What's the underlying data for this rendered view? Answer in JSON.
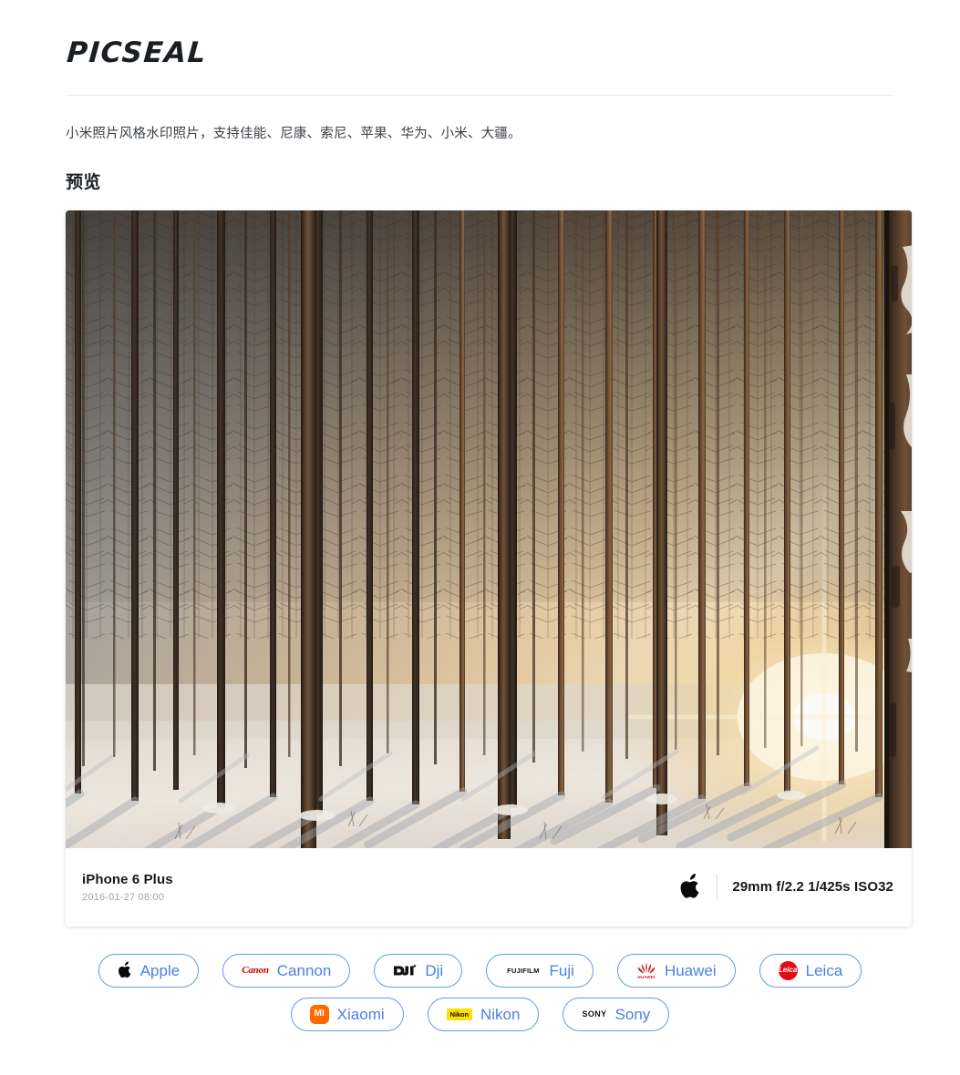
{
  "header": {
    "site_title": "PICSEAL"
  },
  "intro": {
    "description": "小米照片风格水印照片，支持佳能、尼康、索尼、苹果、华为、小米、大疆。"
  },
  "preview": {
    "section_heading": "预览",
    "photo_alt": "winter-larch-forest-sunrise-photo",
    "watermark": {
      "model": "iPhone 6 Plus",
      "date": "2016-01-27 08:00",
      "brand_logo": "apple-logo",
      "exif": "29mm f/2.2 1/425s ISO32"
    }
  },
  "brands": {
    "rows": [
      [
        {
          "label": "Apple",
          "logo": "apple-logo"
        },
        {
          "label": "Cannon",
          "logo": "canon-logo"
        },
        {
          "label": "Dji",
          "logo": "dji-logo"
        },
        {
          "label": "Fuji",
          "logo": "fujifilm-logo"
        },
        {
          "label": "Huawei",
          "logo": "huawei-logo"
        },
        {
          "label": "Leica",
          "logo": "leica-logo"
        }
      ],
      [
        {
          "label": "Xiaomi",
          "logo": "xiaomi-logo"
        },
        {
          "label": "Nikon",
          "logo": "nikon-logo"
        },
        {
          "label": "Sony",
          "logo": "sony-logo"
        }
      ]
    ],
    "logo_text": {
      "canon": "Canon",
      "fujifilm": "FUJIFILM",
      "sony": "SONY",
      "nikon": "Nikon",
      "xiaomi": "MI",
      "leica": "Leica",
      "huawei": "HUAWEI"
    }
  },
  "colors": {
    "accent_blue": "#4a7fe8",
    "pill_border": "#6699f0",
    "canon_red": "#cc0000",
    "huawei_red": "#c8202e",
    "leica_red": "#e20a17",
    "xiaomi_orange": "#ff6900",
    "nikon_yellow": "#ffe100",
    "text_dark": "#1b1f23",
    "text_muted": "#a0a4a8"
  }
}
